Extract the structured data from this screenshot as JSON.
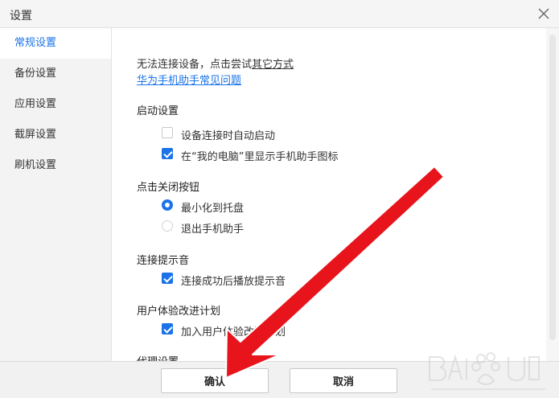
{
  "window": {
    "title": "设置"
  },
  "sidebar": {
    "items": [
      {
        "label": "常规设置"
      },
      {
        "label": "备份设置"
      },
      {
        "label": "应用设置"
      },
      {
        "label": "截屏设置"
      },
      {
        "label": "刷机设置"
      }
    ]
  },
  "connection": {
    "hint_prefix": "无法连接设备，点击尝试",
    "hint_link": "其它方式",
    "faq_link": "华为手机助手常见问题"
  },
  "startup": {
    "heading": "启动设置",
    "auto_start": {
      "label": "设备连接时自动启动",
      "checked": false
    },
    "show_icon": {
      "label": "在“我的电脑”里显示手机助手图标",
      "checked": true
    }
  },
  "close_button": {
    "heading": "点击关闭按钮",
    "minimize": {
      "label": "最小化到托盘",
      "selected": true
    },
    "exit": {
      "label": "退出手机助手",
      "selected": false
    }
  },
  "sound": {
    "heading": "连接提示音",
    "play": {
      "label": "连接成功后播放提示音",
      "checked": true
    }
  },
  "ux": {
    "heading": "用户体验改进计划",
    "join": {
      "label": "加入用户体验改进计划",
      "checked": true
    }
  },
  "proxy": {
    "heading": "代理设置"
  },
  "footer": {
    "confirm_label": "确认",
    "cancel_label": "取消"
  },
  "colors": {
    "accent": "#1a73e8",
    "arrow": "#e8141c"
  }
}
